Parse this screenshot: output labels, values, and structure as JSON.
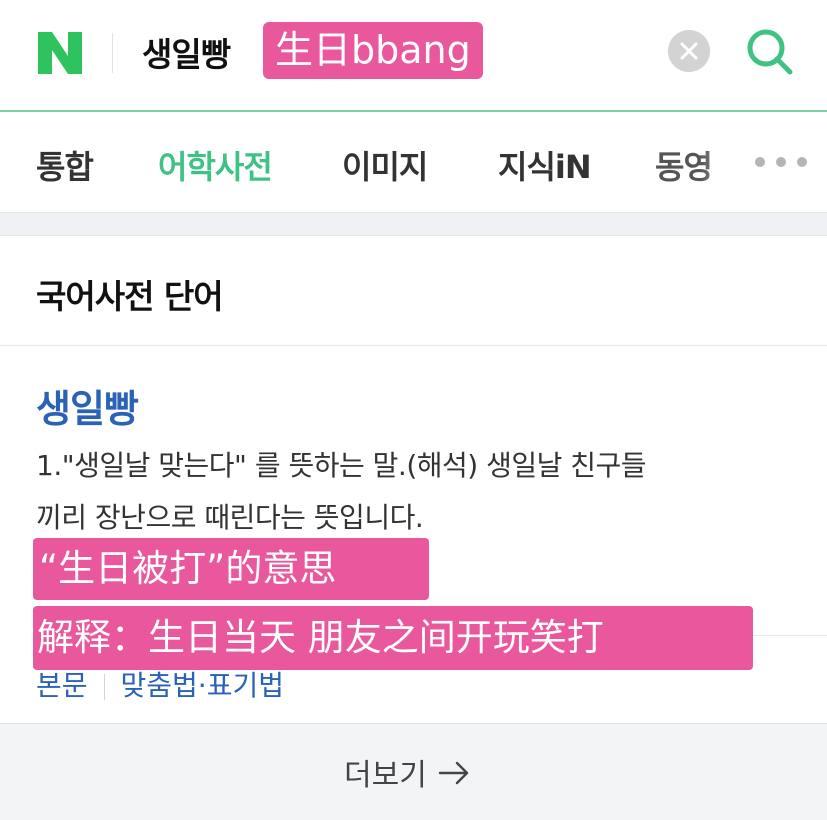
{
  "header": {
    "logo_letter": "N",
    "query": "생일빵",
    "query_annotation": "生日bbang",
    "accent_color": "#3fc283",
    "icons": {
      "clear": "clear-icon",
      "search": "search-icon"
    }
  },
  "tabs": [
    {
      "label": "통합",
      "active": false
    },
    {
      "label": "어학사전",
      "active": true
    },
    {
      "label": "이미지",
      "active": false
    },
    {
      "label": "지식iN",
      "active": false
    },
    {
      "label": "동영",
      "active": false
    }
  ],
  "more_icon": "more-dots-icon",
  "dictionary": {
    "section_title": "국어사전 단어",
    "word": "생일빵",
    "definition_line1": "1.\"생일날 맞는다\" 를 뜻하는 말.(해석) 생일날 친구들",
    "definition_line2": "끼리 장난으로 때린다는 뜻입니다.",
    "annotation_line1": "“生日被打”的意思",
    "annotation_line2": "解释：生日当天 朋友之间开玩笑打",
    "annotation_color": "#e9579c",
    "link1": "본문",
    "link2": "맞춤법·표기법"
  },
  "footer": {
    "more_label": "더보기",
    "arrow_icon": "arrow-right-icon"
  }
}
